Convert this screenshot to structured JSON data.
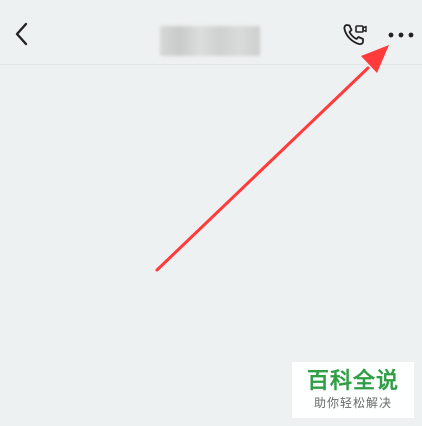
{
  "header": {
    "back_icon": "chevron-left-icon",
    "call_icon": "phone-video-icon",
    "more_icon": "more-horizontal-icon"
  },
  "annotation": {
    "arrow_color": "#ff3b3b",
    "points_to": "more-button"
  },
  "watermark": {
    "title": "百科全说",
    "subtitle": "助你轻松解决",
    "title_color": "#2f9e44"
  }
}
